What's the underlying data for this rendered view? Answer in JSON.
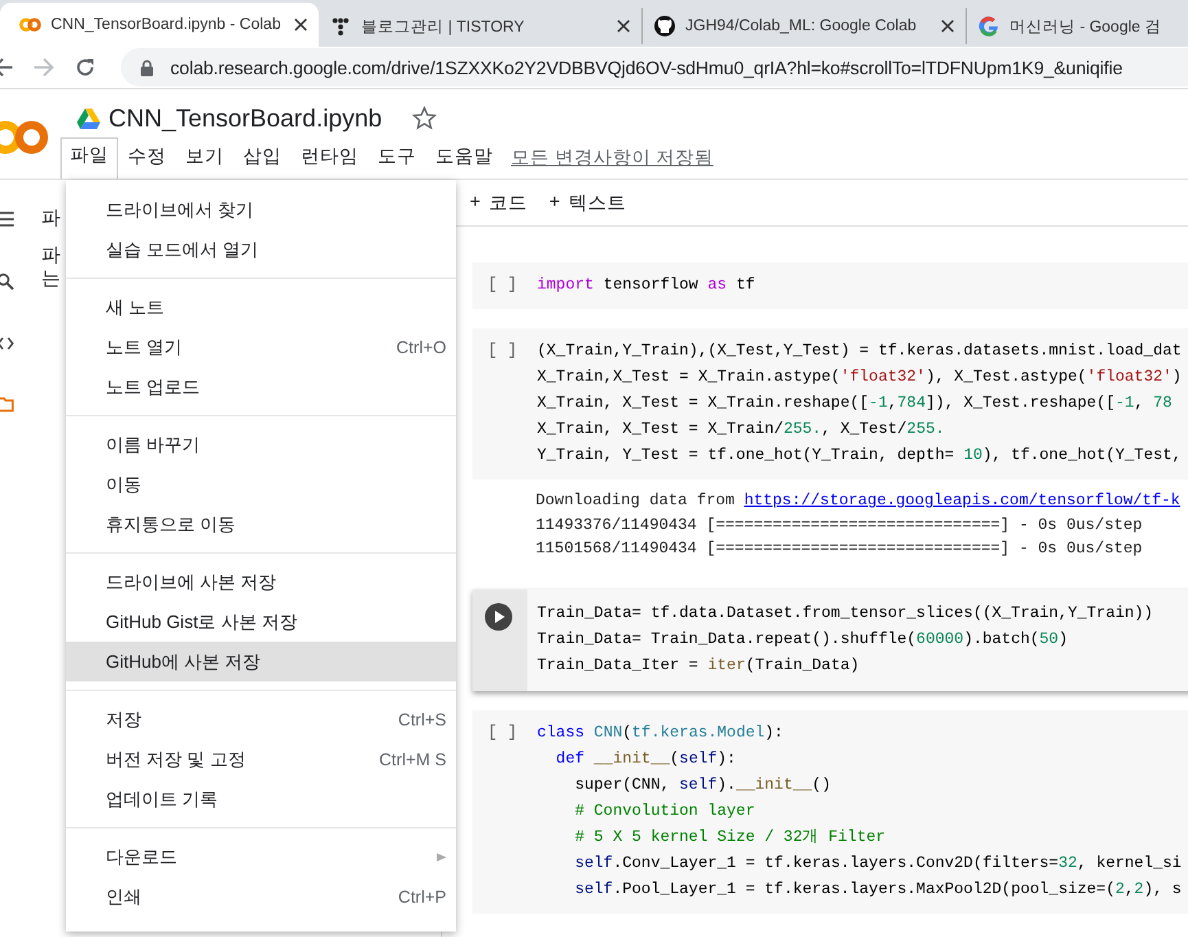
{
  "browser": {
    "tabs": [
      {
        "title": "CNN_TensorBoard.ipynb - Colab",
        "selected": true,
        "closable": true
      },
      {
        "title": "블로그관리 | TISTORY",
        "selected": false,
        "closable": true
      },
      {
        "title": "JGH94/Colab_ML: Google Colab",
        "selected": false,
        "closable": true
      },
      {
        "title": "머신러닝 - Google 검",
        "selected": false,
        "closable": false
      }
    ],
    "url": "colab.research.google.com/drive/1SZXXKo2Y2VDBBVQjd6OV-sdHmu0_qrIA?hl=ko#scrollTo=lTDFNUpm1K9_&uniqifie"
  },
  "notebook": {
    "title": "CNN_TensorBoard.ipynb",
    "menubar": [
      {
        "label": "파일",
        "selected": true
      },
      {
        "label": "수정",
        "selected": false
      },
      {
        "label": "보기",
        "selected": false
      },
      {
        "label": "삽입",
        "selected": false
      },
      {
        "label": "런타임",
        "selected": false
      },
      {
        "label": "도구",
        "selected": false
      },
      {
        "label": "도움말",
        "selected": false
      }
    ],
    "save_status": "모든 변경사항이 저장됨",
    "side_pane": {
      "heading": "파",
      "text_lines": [
        "파",
        "는"
      ]
    },
    "toolbar": [
      {
        "sign": "+",
        "label": "코드"
      },
      {
        "sign": "+",
        "label": "텍스트"
      }
    ],
    "cells": [
      {
        "prompt": "[ ]",
        "focused": false,
        "lines": [
          [
            {
              "text": "import",
              "kind": "control"
            },
            {
              "text": " tensorflow ",
              "kind": "plain"
            },
            {
              "text": "as",
              "kind": "control"
            },
            {
              "text": " tf",
              "kind": "plain"
            }
          ]
        ]
      },
      {
        "prompt": "[ ]",
        "focused": false,
        "lines": [
          [
            {
              "text": "(X_Train,Y_Train),(X_Test,Y_Test) = tf.keras.datasets.mnist.load_dat",
              "kind": "plain"
            }
          ],
          [
            {
              "text": "X_Train,X_Test = X_Train.astype(",
              "kind": "plain"
            },
            {
              "text": "'float32'",
              "kind": "string"
            },
            {
              "text": "), X_Test.astype(",
              "kind": "plain"
            },
            {
              "text": "'float32'",
              "kind": "string"
            },
            {
              "text": ")",
              "kind": "plain"
            }
          ],
          [
            {
              "text": "X_Train, X_Test = X_Train.reshape([",
              "kind": "plain"
            },
            {
              "text": "-1",
              "kind": "number"
            },
            {
              "text": ",",
              "kind": "plain"
            },
            {
              "text": "784",
              "kind": "number"
            },
            {
              "text": "]), X_Test.reshape([",
              "kind": "plain"
            },
            {
              "text": "-1",
              "kind": "number"
            },
            {
              "text": ", ",
              "kind": "plain"
            },
            {
              "text": "78",
              "kind": "number"
            }
          ],
          [
            {
              "text": "X_Train, X_Test = X_Train/",
              "kind": "plain"
            },
            {
              "text": "255.",
              "kind": "number"
            },
            {
              "text": ", X_Test/",
              "kind": "plain"
            },
            {
              "text": "255.",
              "kind": "number"
            }
          ],
          [
            {
              "text": "Y_Train, Y_Test = tf.one_hot(Y_Train, depth= ",
              "kind": "plain"
            },
            {
              "text": "10",
              "kind": "number"
            },
            {
              "text": "), tf.one_hot(Y_Test,",
              "kind": "plain"
            }
          ]
        ],
        "output": [
          {
            "text": "Downloading data from ",
            "link": "https://storage.googleapis.com/tensorflow/tf-k"
          },
          {
            "text": "11493376/11490434 [==============================] - 0s 0us/step"
          },
          {
            "text": "11501568/11490434 [==============================] - 0s 0us/step"
          }
        ]
      },
      {
        "focused": true,
        "lines": [
          [
            {
              "text": "Train_Data= tf.data.Dataset.from_tensor_slices((X_Train,Y_Train))",
              "kind": "plain"
            }
          ],
          [
            {
              "text": "Train_Data= Train_Data.repeat().shuffle(",
              "kind": "plain"
            },
            {
              "text": "60000",
              "kind": "number"
            },
            {
              "text": ").batch(",
              "kind": "plain"
            },
            {
              "text": "50",
              "kind": "number"
            },
            {
              "text": ")",
              "kind": "plain"
            }
          ],
          [
            {
              "text": "Train_Data_Iter = ",
              "kind": "plain"
            },
            {
              "text": "iter",
              "kind": "function"
            },
            {
              "text": "(Train_Data)",
              "kind": "plain"
            }
          ]
        ]
      },
      {
        "prompt": "[ ]",
        "focused": false,
        "lines": [
          [
            {
              "text": "class",
              "kind": "keyword"
            },
            {
              "text": " CNN",
              "kind": "type"
            },
            {
              "text": "(",
              "kind": "plain"
            },
            {
              "text": "tf.keras.Model",
              "kind": "type"
            },
            {
              "text": "):",
              "kind": "plain"
            }
          ],
          [
            {
              "text": "  def",
              "kind": "keyword"
            },
            {
              "text": " __init__",
              "kind": "function"
            },
            {
              "text": "(",
              "kind": "plain"
            },
            {
              "text": "self",
              "kind": "self"
            },
            {
              "text": "):",
              "kind": "plain"
            }
          ],
          [
            {
              "text": "    super(CNN, ",
              "kind": "plain"
            },
            {
              "text": "self",
              "kind": "self"
            },
            {
              "text": ").",
              "kind": "plain"
            },
            {
              "text": "__init__",
              "kind": "function"
            },
            {
              "text": "()",
              "kind": "plain"
            }
          ],
          [
            {
              "text": "    # Convolution layer",
              "kind": "comment"
            }
          ],
          [
            {
              "text": "    # 5 X 5 kernel Size / 32개 Filter",
              "kind": "comment"
            }
          ],
          [
            {
              "text": "    self",
              "kind": "self"
            },
            {
              "text": ".Conv_Layer_1 = tf.keras.layers.Conv2D(filters=",
              "kind": "plain"
            },
            {
              "text": "32",
              "kind": "number"
            },
            {
              "text": ", kernel_si",
              "kind": "plain"
            }
          ],
          [
            {
              "text": "    self",
              "kind": "self"
            },
            {
              "text": ".Pool_Layer_1 = tf.keras.layers.MaxPool2D(pool_size=(",
              "kind": "plain"
            },
            {
              "text": "2",
              "kind": "number"
            },
            {
              "text": ",",
              "kind": "plain"
            },
            {
              "text": "2",
              "kind": "number"
            },
            {
              "text": "), s",
              "kind": "plain"
            }
          ]
        ]
      }
    ]
  },
  "file_menu": {
    "groups": [
      {
        "items": [
          {
            "label": "드라이브에서 찾기",
            "selected": false
          },
          {
            "label": "실습 모드에서 열기",
            "selected": false
          }
        ]
      },
      {
        "items": [
          {
            "label": "새 노트",
            "selected": false
          },
          {
            "label": "노트 열기",
            "shortcut": "Ctrl+O",
            "selected": false
          },
          {
            "label": "노트 업로드",
            "selected": false
          }
        ]
      },
      {
        "items": [
          {
            "label": "이름 바꾸기",
            "selected": false
          },
          {
            "label": "이동",
            "selected": false
          },
          {
            "label": "휴지통으로 이동",
            "selected": false
          }
        ]
      },
      {
        "items": [
          {
            "label": "드라이브에 사본 저장",
            "selected": false
          },
          {
            "label": "GitHub Gist로 사본 저장",
            "selected": false
          },
          {
            "label": "GitHub에 사본 저장",
            "selected": true
          }
        ]
      },
      {
        "items": [
          {
            "label": "저장",
            "shortcut": "Ctrl+S",
            "selected": false
          },
          {
            "label": "버전 저장 및 고정",
            "shortcut": "Ctrl+M S",
            "selected": false
          },
          {
            "label": "업데이트 기록",
            "selected": false
          }
        ]
      },
      {
        "items": [
          {
            "label": "다운로드",
            "submenu": true,
            "selected": false
          },
          {
            "label": "인쇄",
            "shortcut": "Ctrl+P",
            "selected": false
          }
        ]
      }
    ]
  }
}
